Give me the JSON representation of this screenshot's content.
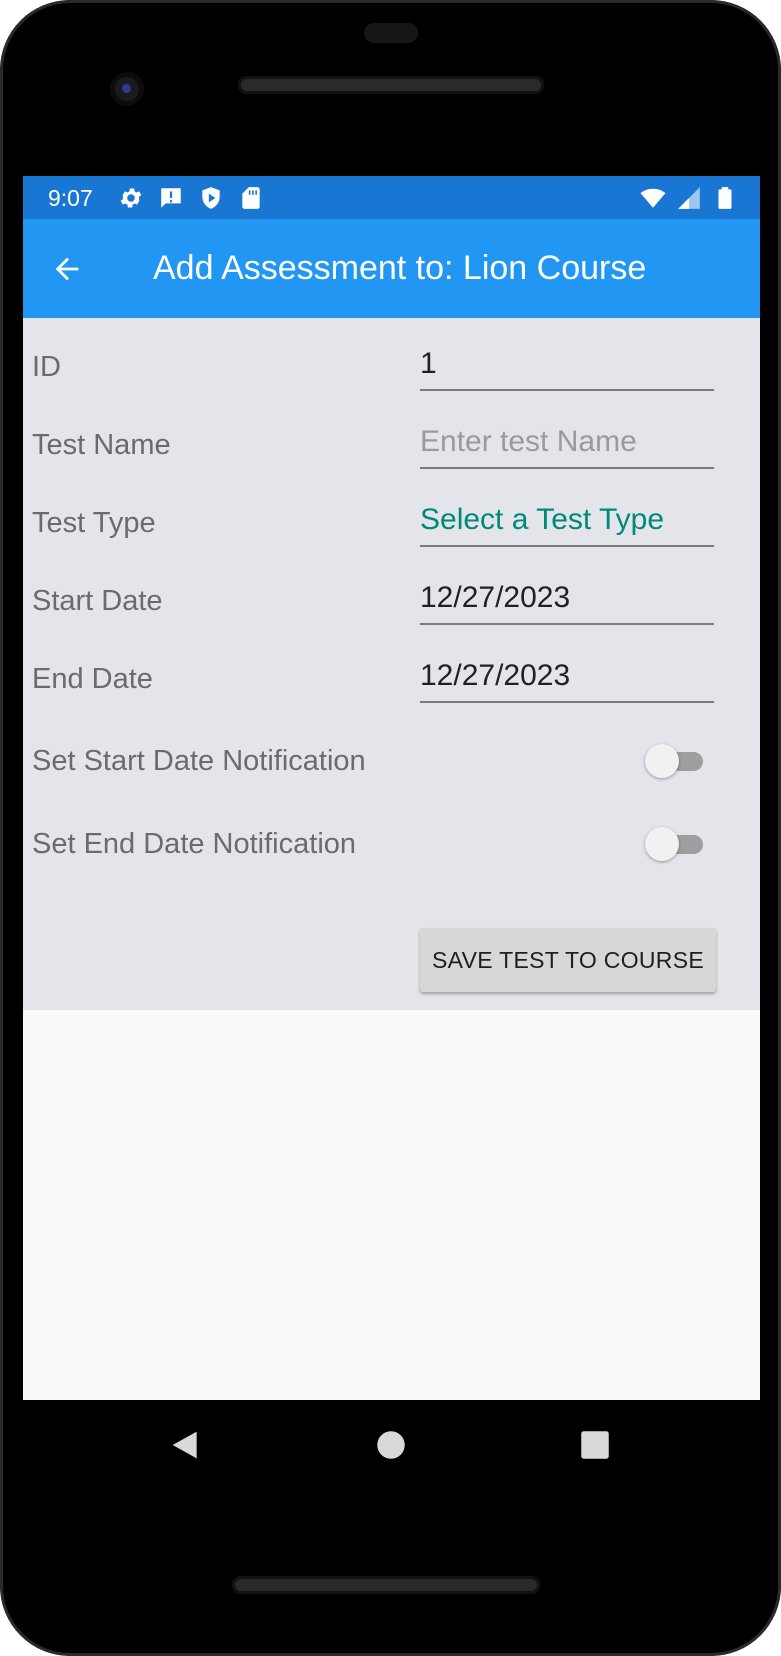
{
  "status_bar": {
    "time": "9:07",
    "left_icons": [
      "settings-icon",
      "alert-message-icon",
      "shield-play-icon",
      "sd-card-icon"
    ],
    "right_icons": [
      "wifi-icon",
      "cell-signal-icon",
      "battery-icon"
    ]
  },
  "toolbar": {
    "title": "Add Assessment to: Lion Course",
    "back_icon": "arrow-back-icon"
  },
  "form": {
    "id": {
      "label": "ID",
      "value": "1"
    },
    "test_name": {
      "label": "Test Name",
      "placeholder": "Enter test Name",
      "value": ""
    },
    "test_type": {
      "label": "Test Type",
      "value": "Select a Test Type"
    },
    "start_date": {
      "label": "Start Date",
      "value": "12/27/2023"
    },
    "end_date": {
      "label": "End Date",
      "value": "12/27/2023"
    },
    "start_notification": {
      "label": "Set Start Date Notification",
      "on": false
    },
    "end_notification": {
      "label": "Set End Date Notification",
      "on": false
    },
    "save_button": "SAVE TEST TO COURSE"
  },
  "nav_bar": {
    "icons": [
      "back-triangle-icon",
      "home-circle-icon",
      "recents-square-icon"
    ]
  },
  "colors": {
    "status_bar": "#1976d2",
    "toolbar": "#2196f3",
    "form_background": "#e4e5ea",
    "picker_text": "#00897b"
  }
}
